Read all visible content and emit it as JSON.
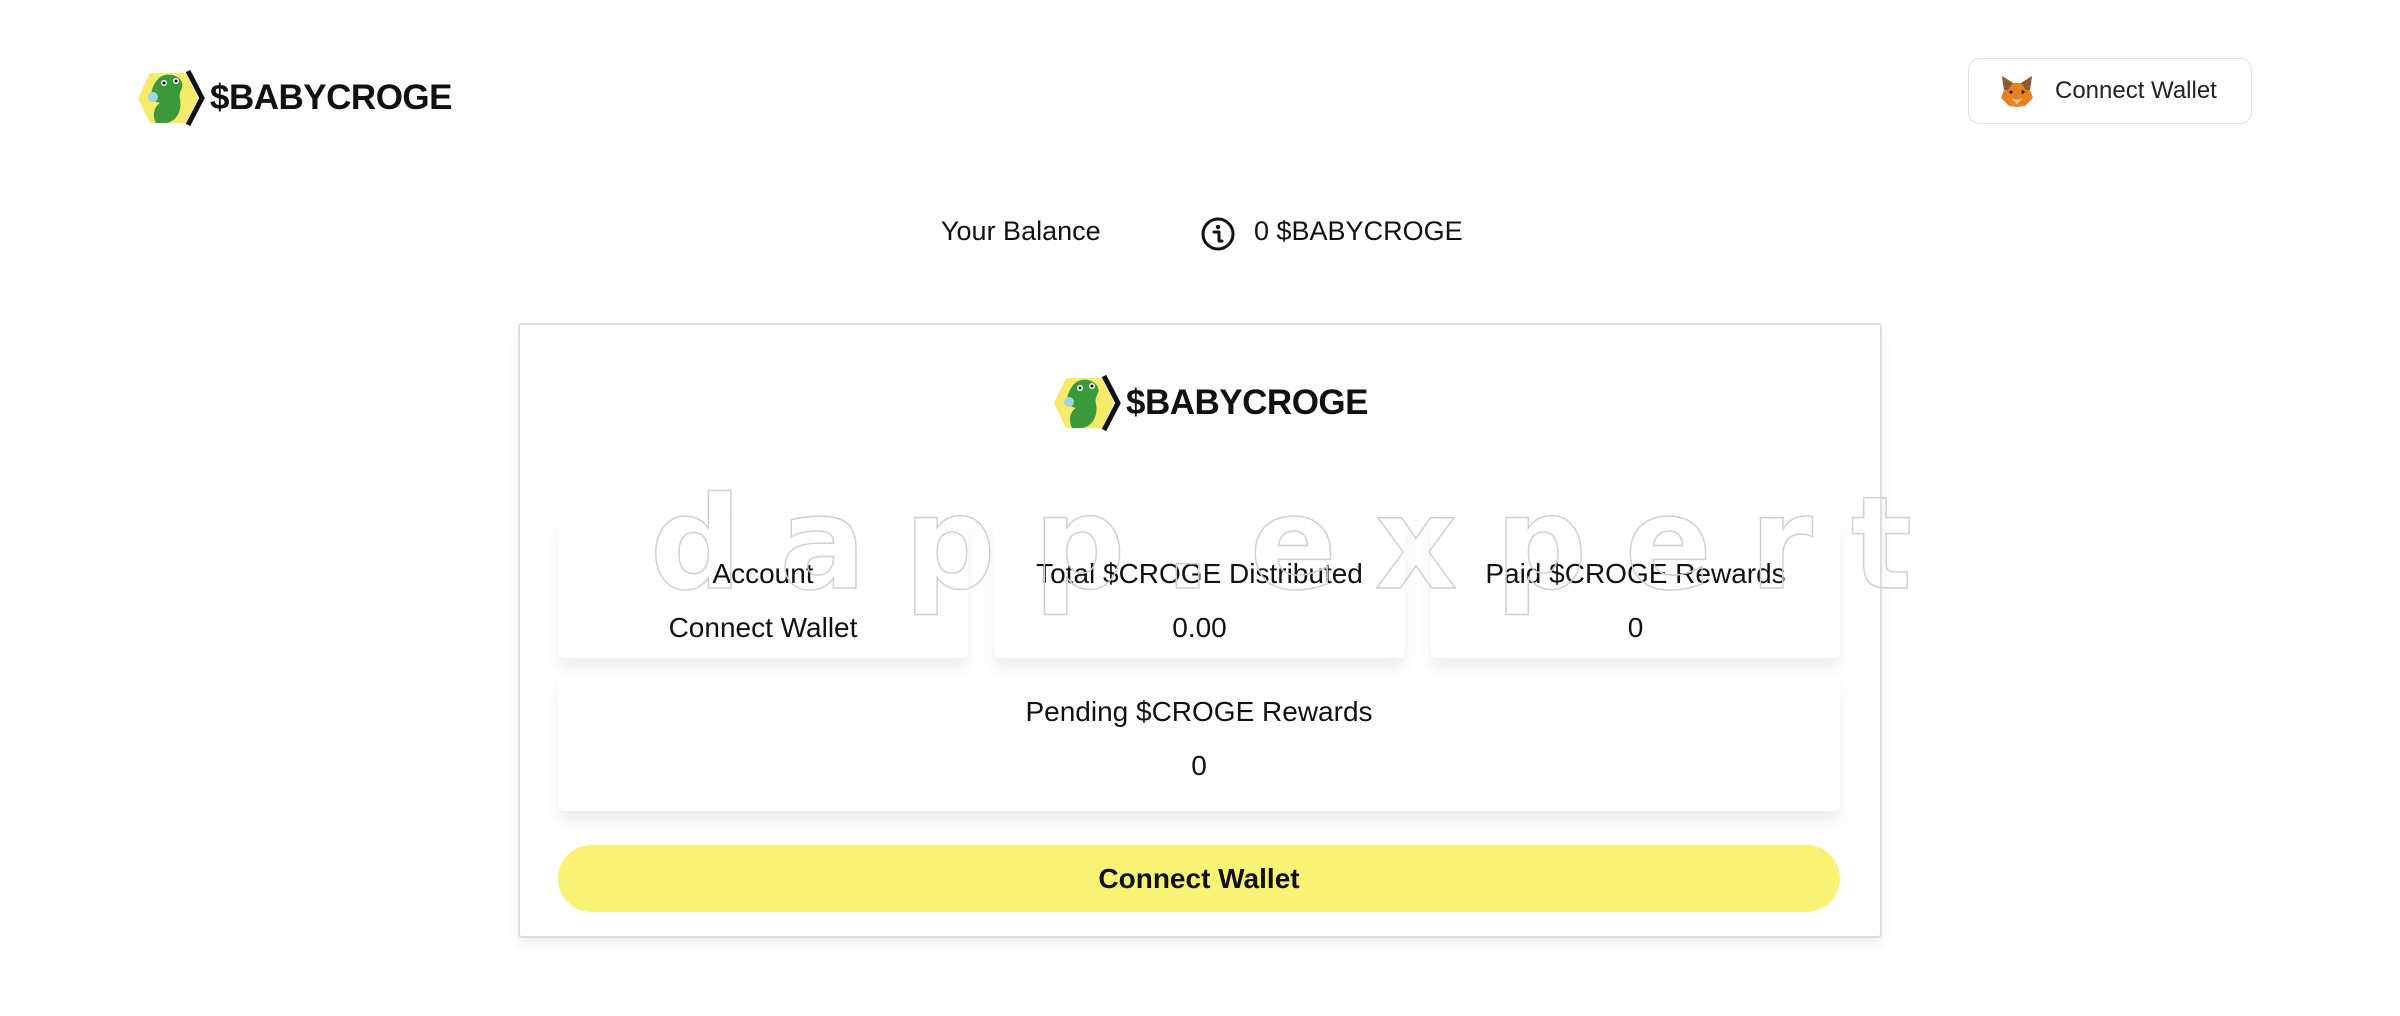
{
  "header": {
    "brand": "$BABYCROGE",
    "connect_wallet_label": "Connect Wallet"
  },
  "balance": {
    "label": "Your Balance",
    "value": "0 $BABYCROGE"
  },
  "card": {
    "brand": "$BABYCROGE",
    "stats": {
      "account": {
        "title": "Account",
        "value": "Connect Wallet"
      },
      "total_distributed": {
        "title": "Total $CROGE Distributed",
        "value": "0.00"
      },
      "paid_rewards": {
        "title": "Paid $CROGE Rewards",
        "value": "0"
      },
      "pending_rewards": {
        "title": "Pending $CROGE Rewards",
        "value": "0"
      }
    },
    "connect_button_label": "Connect Wallet"
  },
  "watermark": "dapp.expert",
  "colors": {
    "accent_yellow": "#f9f375",
    "croc_green": "#3a9a3a",
    "hex_yellow": "#f5ea6a"
  }
}
